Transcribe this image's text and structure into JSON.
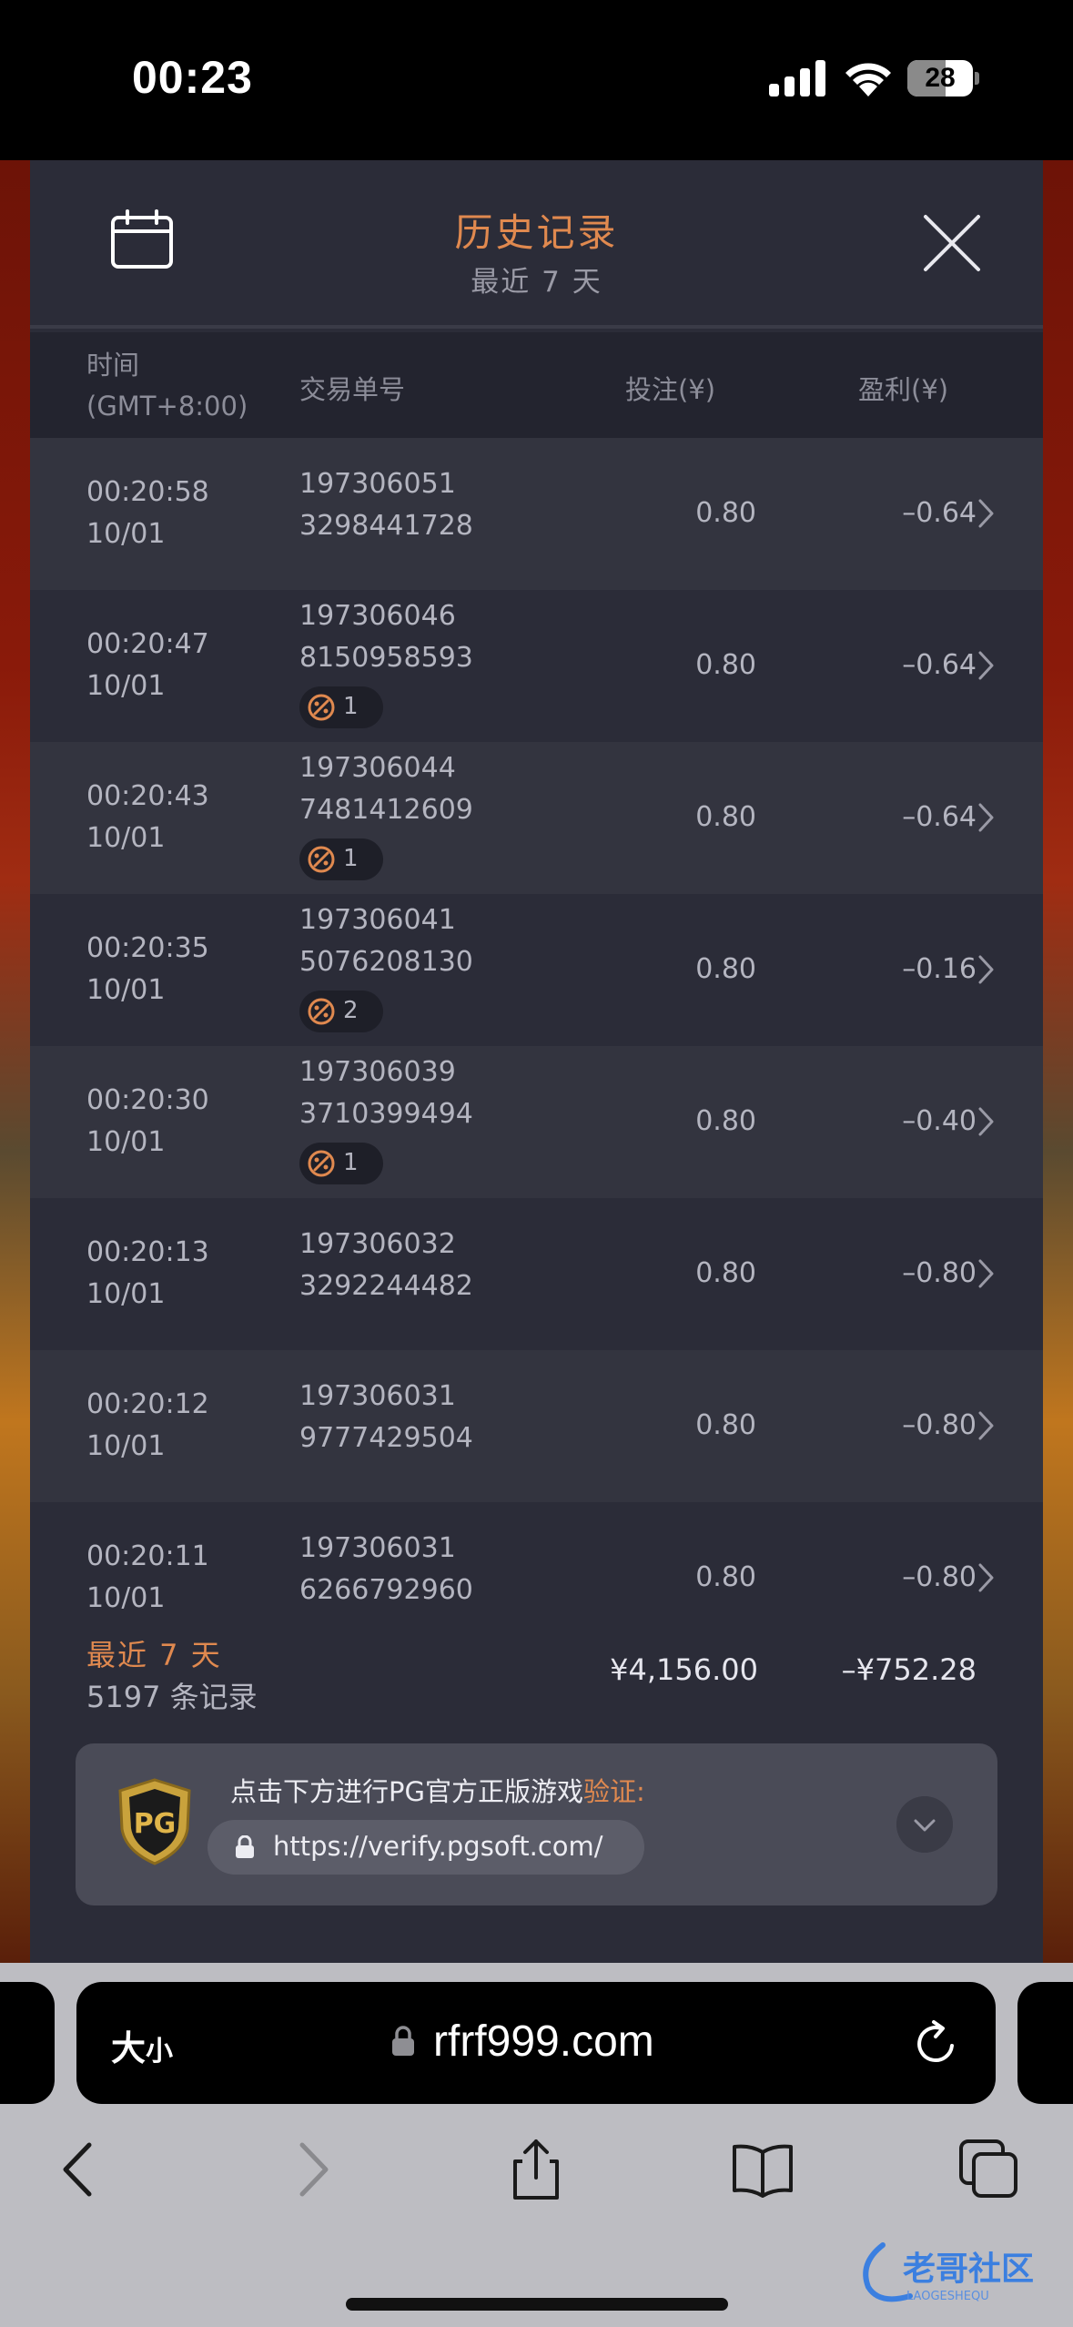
{
  "status_bar": {
    "time": "00:23",
    "battery": "28"
  },
  "header": {
    "title": "历史记录",
    "subtitle": "最近 7 天"
  },
  "columns": {
    "time_line1": "时间",
    "time_line2": "(GMT+8:00)",
    "id": "交易单号",
    "bet": "投注(¥)",
    "profit": "盈利(¥)"
  },
  "rows": [
    {
      "time": "00:20:58",
      "date": "10/01",
      "id1": "197306051",
      "id2": "3298441728",
      "bet": "0.80",
      "profit": "–0.64",
      "badge": ""
    },
    {
      "time": "00:20:47",
      "date": "10/01",
      "id1": "197306046",
      "id2": "8150958593",
      "bet": "0.80",
      "profit": "–0.64",
      "badge": "1"
    },
    {
      "time": "00:20:43",
      "date": "10/01",
      "id1": "197306044",
      "id2": "7481412609",
      "bet": "0.80",
      "profit": "–0.64",
      "badge": "1"
    },
    {
      "time": "00:20:35",
      "date": "10/01",
      "id1": "197306041",
      "id2": "5076208130",
      "bet": "0.80",
      "profit": "–0.16",
      "badge": "2"
    },
    {
      "time": "00:20:30",
      "date": "10/01",
      "id1": "197306039",
      "id2": "3710399494",
      "bet": "0.80",
      "profit": "–0.40",
      "badge": "1"
    },
    {
      "time": "00:20:13",
      "date": "10/01",
      "id1": "197306032",
      "id2": "3292244482",
      "bet": "0.80",
      "profit": "–0.80",
      "badge": ""
    },
    {
      "time": "00:20:12",
      "date": "10/01",
      "id1": "197306031",
      "id2": "9777429504",
      "bet": "0.80",
      "profit": "–0.80",
      "badge": ""
    },
    {
      "time": "00:20:11",
      "date": "10/01",
      "id1": "197306031",
      "id2": "6266792960",
      "bet": "0.80",
      "profit": "–0.80",
      "badge": ""
    }
  ],
  "summary": {
    "label": "最近 7 天",
    "count": "5197 条记录",
    "total_bet": "¥4,156.00",
    "total_profit": "–¥752.28"
  },
  "verify": {
    "text": "点击下方进行PG官方正版游戏",
    "highlight": "验证:",
    "url": "https://verify.pgsoft.com/",
    "logo_text": "PG"
  },
  "browser": {
    "text_size_label": "大",
    "text_size_small": "小",
    "url": "rfrf999.com"
  },
  "watermark": {
    "text": "老哥社区",
    "sub": "LAOGESHEQU"
  },
  "colors": {
    "accent": "#e0894f",
    "panel": "#2b2c38",
    "row_alt": "#33343f"
  },
  "icons": [
    "calendar-icon",
    "close-icon",
    "chevron-right-icon",
    "free-spin-icon",
    "pg-shield-icon",
    "lock-icon",
    "chevron-down-icon",
    "reload-icon",
    "back-icon",
    "forward-icon",
    "share-icon",
    "bookmarks-icon",
    "tabs-icon"
  ]
}
